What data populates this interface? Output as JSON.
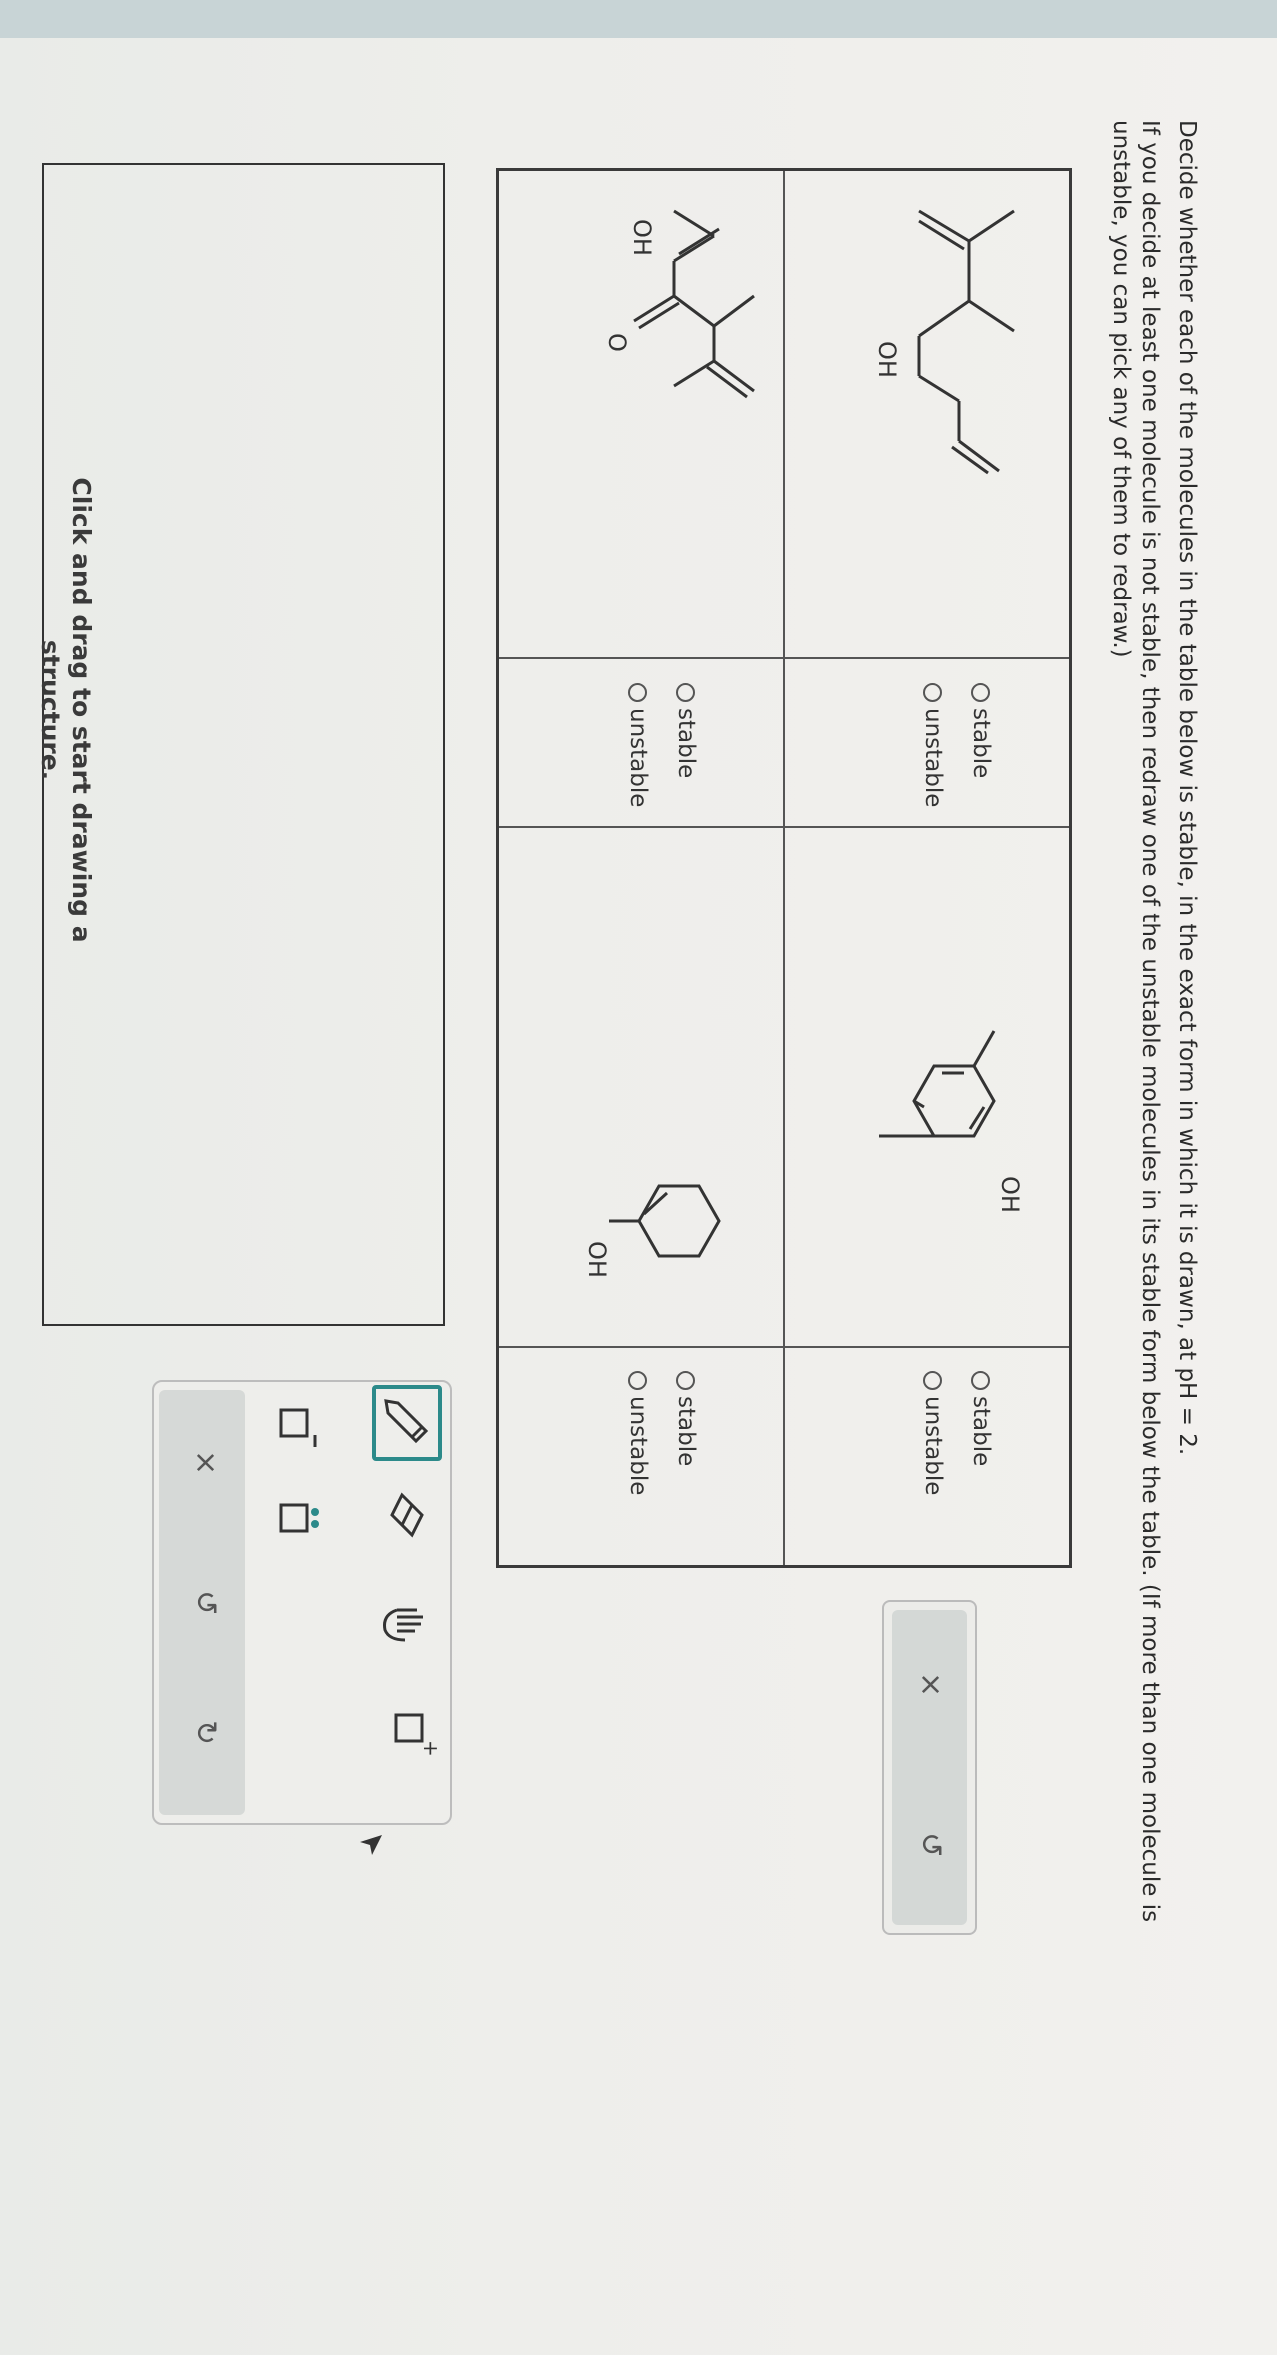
{
  "question": {
    "line1": "Decide whether each of the molecules in the table below is stable, in the exact form in which it is drawn, at pH = 2.",
    "line2": "If you decide at least one molecule is not stable, then redraw one of the unstable molecules in its stable form below the table. (If more than one molecule is",
    "line3": "unstable, you can pick any of them to redraw.)"
  },
  "molecules": [
    {
      "label": "OH",
      "options": [
        "stable",
        "unstable"
      ]
    },
    {
      "label": "OH",
      "options": [
        "stable",
        "unstable"
      ]
    },
    {
      "labels": [
        "OH",
        "O"
      ],
      "options": [
        "stable",
        "unstable"
      ]
    },
    {
      "label": "OH",
      "options": [
        "stable",
        "unstable"
      ]
    }
  ],
  "answer_panel": {
    "clear_icon": "×",
    "undo_icon": "↺"
  },
  "drawing_area": {
    "hint": "Click and drag to start drawing a structure.",
    "hint_line1": "Click and drag to start drawing a",
    "hint_line2": "structure."
  },
  "tools": {
    "bottom_clear_icon": "×",
    "bottom_undo_icon": "↺",
    "bottom_redo_icon": "↻"
  }
}
